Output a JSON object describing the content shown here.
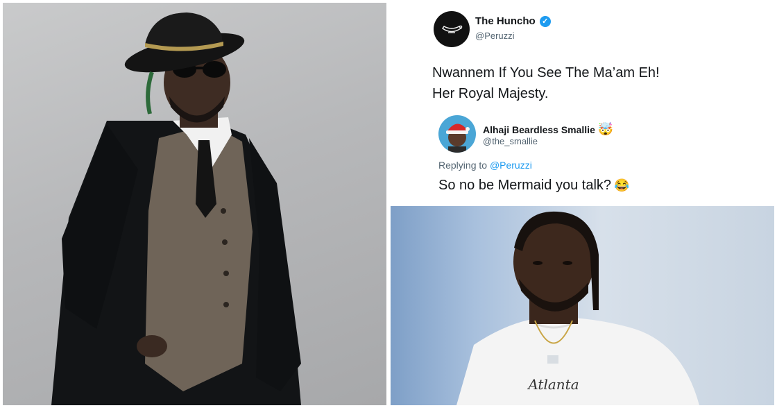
{
  "tweet": {
    "author_name": "The Huncho",
    "author_handle": "@Peruzzi",
    "text_line1": "Nwannem If You See The Ma’am Eh!",
    "text_line2": "Her Royal Majesty.",
    "reply": {
      "author_name": "Alhaji Beardless Smallie",
      "author_emoji": "🤯",
      "author_handle": "@the_smallie",
      "replying_prefix": "Replying to",
      "replying_mention": "@Peruzzi",
      "text": "So no be Mermaid you talk?",
      "text_emoji": "😂"
    }
  },
  "right_photo": {
    "shirt_text": "Atlanta"
  },
  "colors": {
    "verified": "#1d9bf0",
    "mention": "#1d9bf0",
    "name": "#14171a",
    "handle": "#536471"
  }
}
